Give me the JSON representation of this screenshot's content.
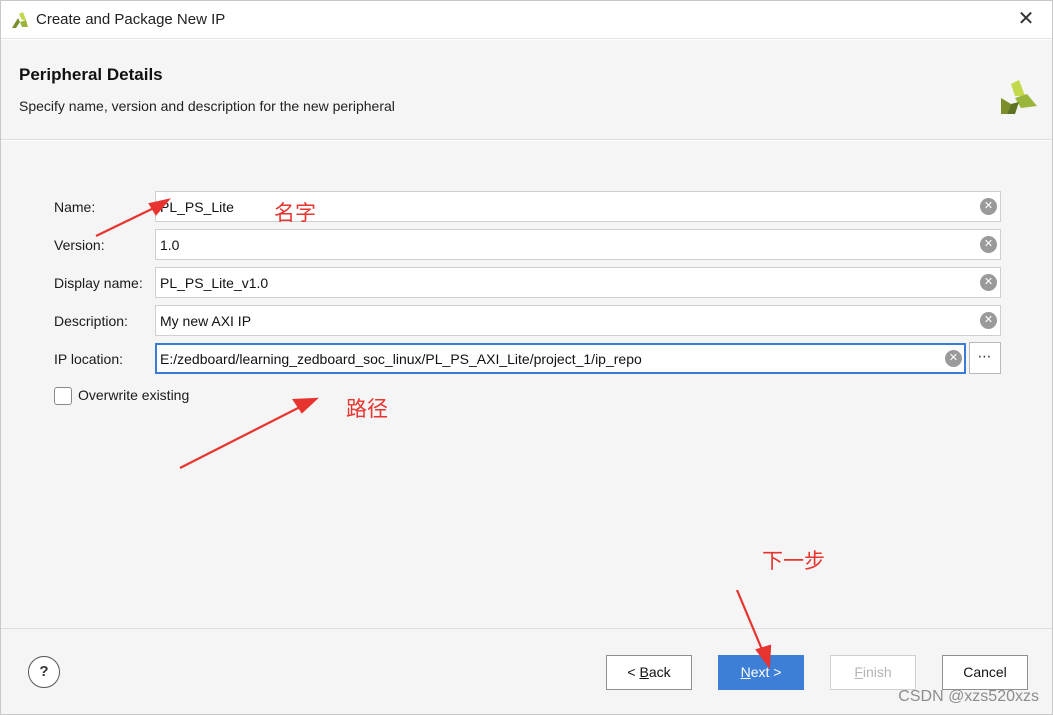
{
  "window": {
    "title": "Create and Package New IP",
    "close_icon": "close-icon"
  },
  "header": {
    "title": "Peripheral Details",
    "subtitle": "Specify name, version and description for the new peripheral",
    "logo": "vivado-logo"
  },
  "form": {
    "fields": [
      {
        "label": "Name:",
        "value": "PL_PS_Lite"
      },
      {
        "label": "Version:",
        "value": "1.0"
      },
      {
        "label": "Display name:",
        "value": "PL_PS_Lite_v1.0"
      },
      {
        "label": "Description:",
        "value": "My new AXI IP"
      },
      {
        "label": "IP location:",
        "value": "E:/zedboard/learning_zedboard_soc_linux/PL_PS_AXI_Lite/project_1/ip_repo"
      }
    ],
    "browse_label": "⋯",
    "overwrite": {
      "label": "Overwrite existing",
      "checked": false
    }
  },
  "footer": {
    "help_label": "?",
    "back_prefix": "< ",
    "back_mnemonic": "B",
    "back_rest": "ack",
    "next_mnemonic": "N",
    "next_rest": "ext >",
    "finish_mnemonic": "F",
    "finish_rest": "inish",
    "cancel_label": "Cancel"
  },
  "annotations": {
    "name_note": "名字",
    "path_note": "路径",
    "next_note": "下一步",
    "color": "#e8342f"
  },
  "watermark": "CSDN @xzs520xzs",
  "colors": {
    "accent": "#3d7fd6",
    "annotation": "#e8342f",
    "logo_green": "#9ab63a"
  }
}
